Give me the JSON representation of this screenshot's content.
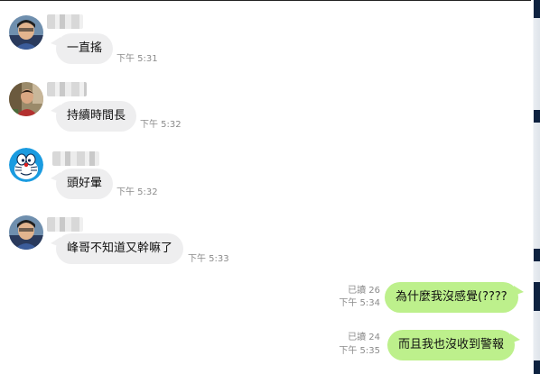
{
  "colors": {
    "incoming_bubble": "#eeeeef",
    "outgoing_bubble": "#bdf08c",
    "meta_text": "#8b8b8b"
  },
  "messages": [
    {
      "direction": "incoming",
      "avatar_icon": "person-photo-avatar",
      "text": "一直搖",
      "time": "下午 5:31"
    },
    {
      "direction": "incoming",
      "avatar_icon": "person-photo-avatar",
      "text": "持續時間長",
      "time": "下午 5:32"
    },
    {
      "direction": "incoming",
      "avatar_icon": "cartoon-cat-avatar",
      "text": "頭好暈",
      "time": "下午 5:32"
    },
    {
      "direction": "incoming",
      "avatar_icon": "person-photo-avatar",
      "text": "峰哥不知道又幹嘛了",
      "time": "下午 5:33"
    },
    {
      "direction": "outgoing",
      "text": "為什麼我沒感覺(????",
      "read": "已讀 26",
      "time": "下午 5:34"
    },
    {
      "direction": "outgoing",
      "text": "而且我也沒收到警報",
      "read": "已讀 24",
      "time": "下午 5:35"
    }
  ]
}
